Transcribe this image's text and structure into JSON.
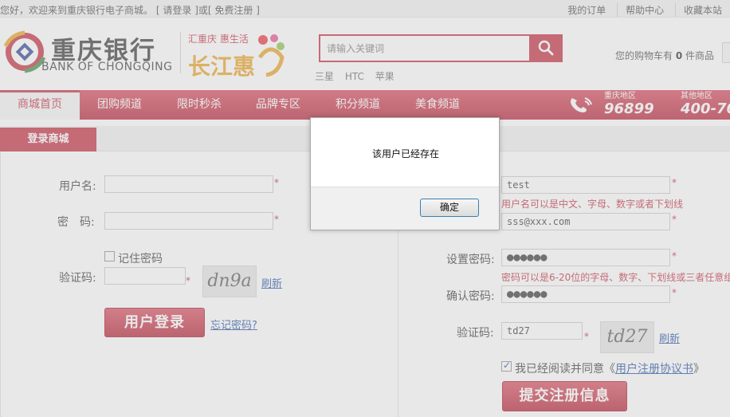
{
  "topbar": {
    "welcome": "您好，欢迎来到重庆银行电子商城。",
    "login_open": "[",
    "login": "请登录",
    "login_close": "]或[",
    "register": "免费注册",
    "register_close": "]",
    "links": [
      "我的订单",
      "帮助中心",
      "收藏本站"
    ]
  },
  "logo": {
    "cn": "重庆银行",
    "en": "BANK OF CHONGQING"
  },
  "brand2": {
    "slogan": "汇重庆 惠生活",
    "big": "长江惠"
  },
  "search": {
    "placeholder": "请输入关键词",
    "hotwords": [
      "三星",
      "HTC",
      "苹果"
    ]
  },
  "cart": {
    "prefix": "您的购物车有",
    "count": "0",
    "suffix": "件商品"
  },
  "nav": {
    "items": [
      "商城首页",
      "团购频道",
      "限时秒杀",
      "品牌专区",
      "积分频道",
      "美食频道"
    ],
    "phone1_label": "重庆地区",
    "phone1_num": "96899",
    "phone2_label": "其他地区",
    "phone2_num": "400-70"
  },
  "section": {
    "tab": "登录商城"
  },
  "login_form": {
    "username_label": "用户名:",
    "password_label": "密　码:",
    "remember_label": "记住密码",
    "captcha_label": "验证码:",
    "captcha_text": "dn9a",
    "refresh": "刷新",
    "submit": "用户登录",
    "forgot": "忘记密码?",
    "star": "*"
  },
  "register_form": {
    "username_value": "test",
    "username_hint": "用户名可以是中文、字母、数字或者下划线",
    "email_value": "sss@xxx.com",
    "password_label": "设置密码:",
    "password_value": "●●●●●●",
    "password_hint": "密码可以是6-20位的字母、数字、下划线或三者任意组",
    "confirm_label": "确认密码:",
    "confirm_value": "●●●●●●",
    "captcha_label": "验证码:",
    "captcha_value": "td27",
    "captcha_text": "td27",
    "refresh": "刷新",
    "agree_text": "我已经阅读并同意《",
    "agree_link": "用户注册协议书",
    "agree_close": "》",
    "submit": "提交注册信息",
    "star": "*"
  },
  "dialog": {
    "message": "该用户已经存在",
    "ok": "确定"
  },
  "colors": {
    "brand_red": "#c2283c",
    "link_blue": "#1a4ca0",
    "logo_orange": "#e8a020"
  }
}
